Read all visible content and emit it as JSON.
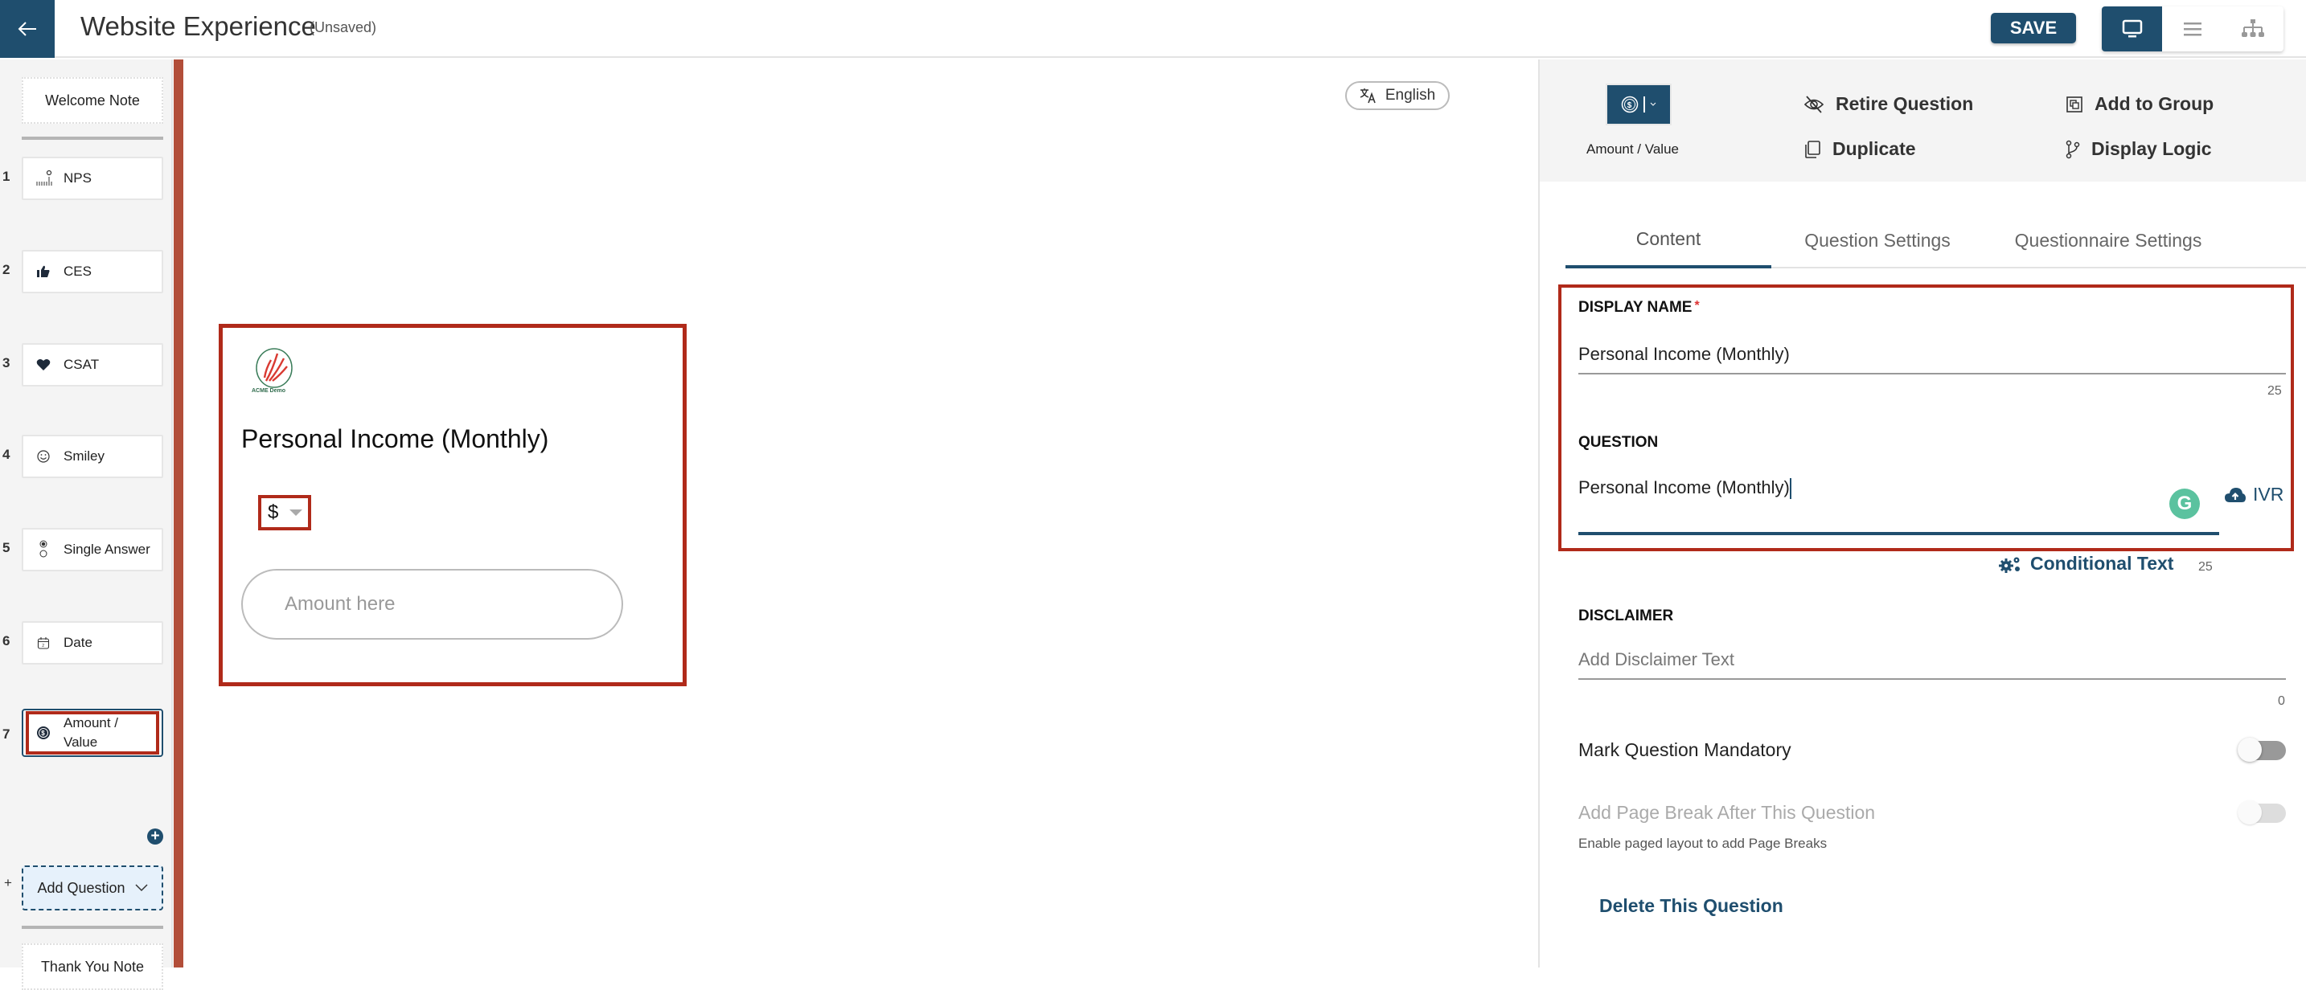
{
  "header": {
    "title": "Website Experience",
    "status": "(Unsaved)",
    "save_label": "SAVE",
    "views": [
      {
        "name": "desktop-view",
        "icon": "monitor-icon",
        "active": true
      },
      {
        "name": "list-view",
        "icon": "list-icon",
        "active": false
      },
      {
        "name": "tree-view",
        "icon": "sitemap-icon",
        "active": false
      }
    ]
  },
  "sidebar": {
    "welcome_label": "Welcome Note",
    "thankyou_label": "Thank You Note",
    "add_question_label": "Add Question",
    "add_plus": "+",
    "questions": [
      {
        "num": "1",
        "label": "NPS",
        "icon": "nps-scale-icon"
      },
      {
        "num": "2",
        "label": "CES",
        "icon": "thumbs-up-icon"
      },
      {
        "num": "3",
        "label": "CSAT",
        "icon": "heart-icon"
      },
      {
        "num": "4",
        "label": "Smiley",
        "icon": "smiley-icon"
      },
      {
        "num": "5",
        "label": "Single Answer",
        "icon": "radio-icon"
      },
      {
        "num": "6",
        "label": "Date",
        "icon": "calendar-icon"
      },
      {
        "num": "7",
        "label": "Amount / Value",
        "icon": "dollar-circle-icon",
        "selected": true
      }
    ]
  },
  "canvas": {
    "language": "English",
    "logo_text": "ACME Demo",
    "question_text": "Personal Income (Monthly)",
    "currency": "$",
    "amount_placeholder": "Amount here"
  },
  "panel": {
    "question_type": "Amount / Value",
    "actions": {
      "retire": "Retire Question",
      "add_group": "Add to Group",
      "duplicate": "Duplicate",
      "display_logic": "Display Logic"
    },
    "tabs": [
      {
        "label": "Content",
        "active": true
      },
      {
        "label": "Question Settings",
        "active": false
      },
      {
        "label": "Questionnaire Settings",
        "active": false
      }
    ],
    "display_name_label": "DISPLAY NAME",
    "required_mark": "*",
    "display_name_value": "Personal Income (Monthly)",
    "display_name_count": "25",
    "question_label": "QUESTION",
    "question_value": "Personal Income (Monthly)",
    "grammarly_letter": "G",
    "ivr_label": "IVR",
    "conditional_text_label": "Conditional Text",
    "question_count": "25",
    "disclaimer_label": "DISCLAIMER",
    "disclaimer_placeholder": "Add Disclaimer Text",
    "disclaimer_count": "0",
    "mandatory_label": "Mark Question Mandatory",
    "mandatory_on": false,
    "page_break_label": "Add Page Break After This Question",
    "page_break_on": false,
    "page_break_helper": "Enable paged layout to add Page Breaks",
    "delete_label": "Delete This Question"
  },
  "colors": {
    "brand": "#1f4e6e",
    "highlight": "#b02a1a",
    "sidebar_bar": "#b24e39",
    "grammarly": "#5bc29f"
  }
}
